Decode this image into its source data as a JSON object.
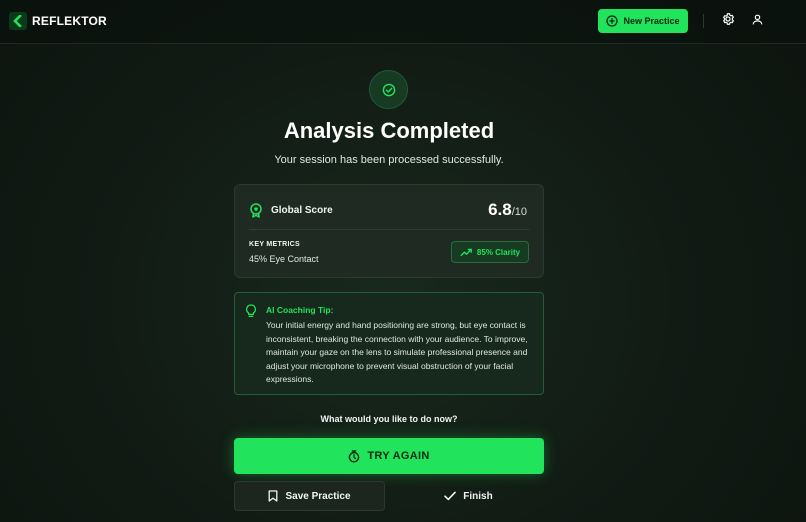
{
  "header": {
    "brand": "REFLEKTOR",
    "new_practice_label": "New Practice",
    "icons": [
      "logo-chevron-icon",
      "plus-circle-icon",
      "gear-icon",
      "user-icon"
    ]
  },
  "result": {
    "status_icon": "check-circle-icon",
    "title": "Analysis Completed",
    "subtitle": "Your session has been processed successfully."
  },
  "score_card": {
    "icon": "target-badge-icon",
    "label": "Global Score",
    "score": "6.8",
    "score_suffix": "/10",
    "key_metrics_label": "KEY METRICS",
    "key_metric_value": "45% Eye Contact",
    "badge_icon": "trending-up-icon",
    "badge_text": "85% Clarity"
  },
  "tip": {
    "icon": "lightbulb-icon",
    "title": "AI Coaching Tip:",
    "body": "Your initial energy and hand positioning are strong, but eye contact is inconsistent, breaking the connection with your audience. To improve, maintain your gaze on the lens to simulate professional presence and adjust your microphone to prevent visual obstruction of your facial expressions."
  },
  "actions": {
    "question": "What would you like to do now?",
    "try_again_label": "TRY AGAIN",
    "save_label": "Save Practice",
    "finish_label": "Finish"
  },
  "colors": {
    "accent": "#22e35c",
    "background": "#111b14",
    "card": "#1f2a23",
    "tip_card": "#17281d"
  }
}
